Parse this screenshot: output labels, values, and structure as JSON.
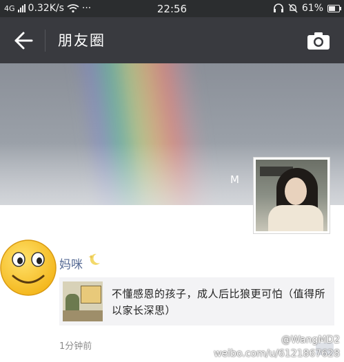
{
  "status_bar": {
    "network_label": "4G",
    "speed": "0.32K/s",
    "more": "···",
    "time": "22:56",
    "battery": "61%",
    "battery_level": 0.61,
    "icons": [
      "signal-icon",
      "wifi-icon",
      "headphones-icon",
      "mute-bell-icon",
      "battery-icon"
    ]
  },
  "header": {
    "back_icon": "arrow-left-icon",
    "title": "朋友圈",
    "camera_icon": "camera-icon"
  },
  "cover": {
    "mark": "M"
  },
  "post": {
    "author": "妈咪",
    "shared_link": {
      "text": "不懂感恩的孩子，成人后比狼更可怕（值得所以家长深思）"
    },
    "time": "1分钟前"
  },
  "watermark": {
    "line1": "@WangMD2",
    "line2": "weibo.com/u/6121867628"
  },
  "colors": {
    "status_bg": "#2b2d2f",
    "header_bg": "#393a3f",
    "name_link": "#576b95",
    "card_bg": "#f3f3f5",
    "time_text": "#8c8c8c"
  }
}
